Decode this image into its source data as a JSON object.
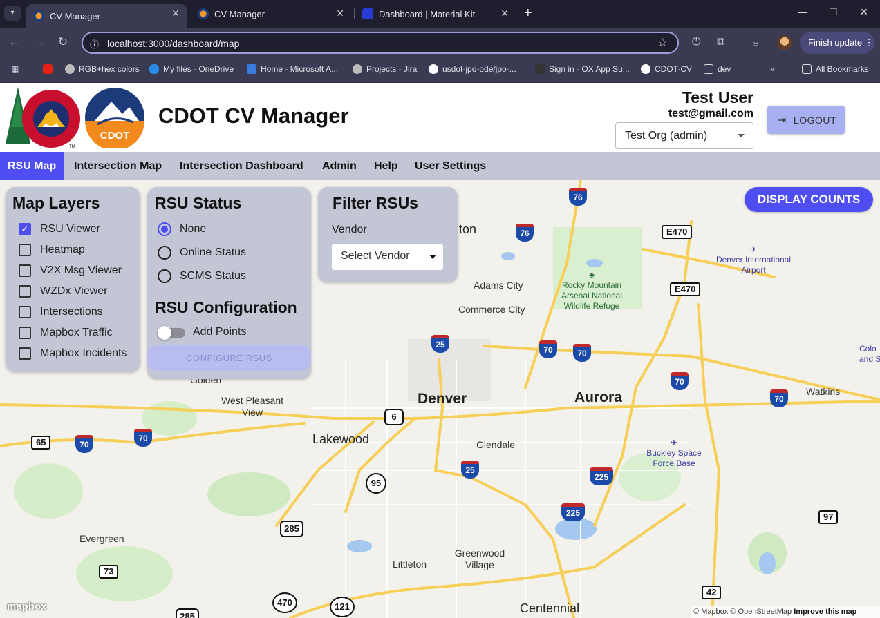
{
  "browser": {
    "tabs": [
      {
        "title": "CV Manager",
        "active": true
      },
      {
        "title": "CV Manager",
        "active": false
      },
      {
        "title": "Dashboard | Material Kit",
        "active": false
      }
    ],
    "url": "localhost:3000/dashboard/map",
    "finish_update": "Finish update",
    "bookmarks": [
      "RGB+hex colors",
      "My files - OneDrive",
      "Home - Microsoft A...",
      "Projects - Jira",
      "usdot-jpo-ode/jpo-...",
      "Sign in - OX App Su...",
      "CDOT-CV",
      "dev"
    ],
    "all_bookmarks": "All Bookmarks"
  },
  "header": {
    "app_title": "CDOT CV Manager",
    "user_name": "Test User",
    "user_email": "test@gmail.com",
    "org_select": "Test Org (admin)",
    "logout_label": "LOGOUT",
    "cdot_logo_text": "CDOT",
    "tm": "TM"
  },
  "menu": {
    "items": [
      "RSU Map",
      "Intersection Map",
      "Intersection Dashboard",
      "Admin",
      "Help",
      "User Settings"
    ],
    "active": "RSU Map"
  },
  "layers_panel": {
    "title": "Map Layers",
    "items": [
      {
        "label": "RSU Viewer",
        "checked": true
      },
      {
        "label": "Heatmap",
        "checked": false
      },
      {
        "label": "V2X Msg Viewer",
        "checked": false
      },
      {
        "label": "WZDx Viewer",
        "checked": false
      },
      {
        "label": "Intersections",
        "checked": false
      },
      {
        "label": "Mapbox Traffic",
        "checked": false
      },
      {
        "label": "Mapbox Incidents",
        "checked": false
      }
    ]
  },
  "status_panel": {
    "title": "RSU Status",
    "options": [
      {
        "label": "None",
        "selected": true
      },
      {
        "label": "Online Status",
        "selected": false
      },
      {
        "label": "SCMS Status",
        "selected": false
      }
    ],
    "config_title": "RSU Configuration",
    "add_points_label": "Add Points",
    "add_points_on": false,
    "configure_button": "CONFIGURE RSUS"
  },
  "filter_panel": {
    "title": "Filter RSUs",
    "vendor_label": "Vendor",
    "vendor_select": "Select Vendor"
  },
  "display_counts": "DISPLAY COUNTS",
  "map": {
    "cities_big": [
      "Denver",
      "Aurora"
    ],
    "cities_mid": [
      "Lakewood",
      "Centennial"
    ],
    "cities_small": [
      "Adams City",
      "Commerce City",
      "West Pleasant View",
      "Glendale",
      "Evergreen",
      "Littleton",
      "Greenwood Village",
      "Watkins",
      "Golden",
      "Colo and S",
      "ton"
    ],
    "pois": [
      "Denver International Airport",
      "Rocky Mountain Arsenal National Wildlife Refuge",
      "Buckley Space Force Base"
    ],
    "interstates": [
      "76",
      "76",
      "25",
      "70",
      "70",
      "70",
      "70",
      "70",
      "70",
      "25",
      "225",
      "225"
    ],
    "us_routes": [
      "6",
      "285",
      "285"
    ],
    "state_routes": [
      "95",
      "470",
      "121"
    ],
    "rect_routes": [
      "E470",
      "E470",
      "65",
      "73",
      "97",
      "42"
    ],
    "mapbox_logo": "mapbox",
    "attribution_1": "© Mapbox",
    "attribution_2": "© OpenStreetMap",
    "attribution_3": "Improve this map"
  }
}
